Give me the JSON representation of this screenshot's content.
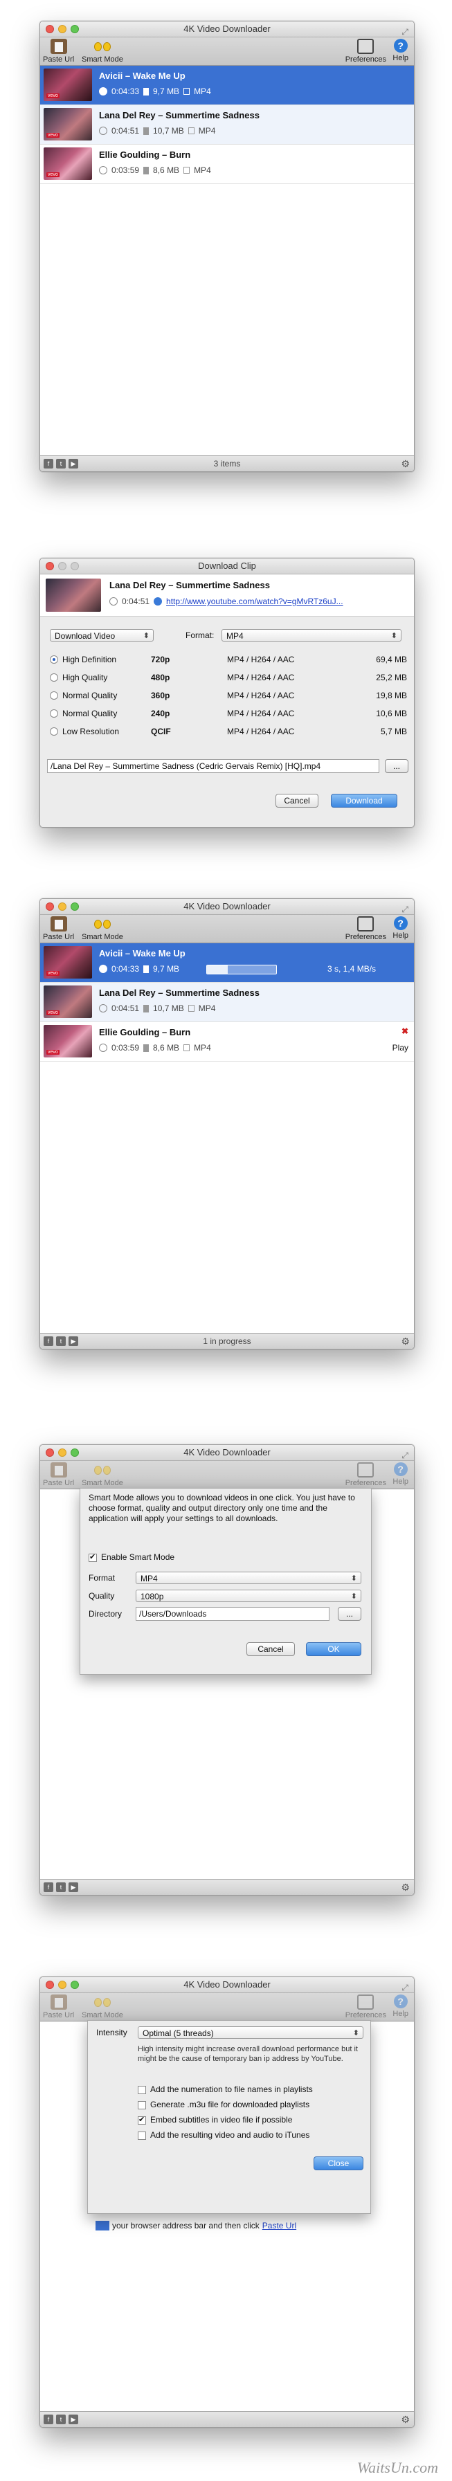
{
  "app": {
    "title": "4K Video Downloader"
  },
  "toolbar": {
    "paste_url": "Paste Url",
    "smart_mode": "Smart Mode",
    "preferences": "Preferences",
    "help": "Help",
    "help_glyph": "?"
  },
  "items": [
    {
      "title": "Avicii – Wake Me Up",
      "duration": "0:04:33",
      "size": "9,7 MB",
      "format": "MP4"
    },
    {
      "title": "Lana Del Rey – Summertime Sadness",
      "duration": "0:04:51",
      "size": "10,7 MB",
      "format": "MP4"
    },
    {
      "title": "Ellie Goulding – Burn",
      "duration": "0:03:59",
      "size": "8,6 MB",
      "format": "MP4"
    }
  ],
  "thumb_badge": "vevo",
  "status1": "3 items",
  "status2": "1 in progress",
  "download_progress": {
    "percent": 30,
    "label": "3 s, 1,4 MB/s"
  },
  "burn_action": "Play",
  "dialog": {
    "title": "Download Clip",
    "clip_title": "Lana Del Rey – Summertime Sadness",
    "duration": "0:04:51",
    "url": "http://www.youtube.com/watch?v=gMvRTz6uJ...",
    "action": "Download Video",
    "format_label": "Format:",
    "format_value": "MP4",
    "qualities": [
      {
        "name": "High Definition",
        "res": "720p",
        "codec": "MP4 / H264 / AAC",
        "size": "69,4 MB",
        "selected": true
      },
      {
        "name": "High Quality",
        "res": "480p",
        "codec": "MP4 / H264 / AAC",
        "size": "25,2 MB",
        "selected": false
      },
      {
        "name": "Normal Quality",
        "res": "360p",
        "codec": "MP4 / H264 / AAC",
        "size": "19,8 MB",
        "selected": false
      },
      {
        "name": "Normal Quality",
        "res": "240p",
        "codec": "MP4 / H264 / AAC",
        "size": "10,6 MB",
        "selected": false
      },
      {
        "name": "Low Resolution",
        "res": "QCIF",
        "codec": "MP4 / H264 / AAC",
        "size": "5,7 MB",
        "selected": false
      }
    ],
    "filepath": "/Lana Del Rey – Summertime Sadness (Cedric Gervais Remix) [HQ].mp4",
    "browse": "...",
    "cancel": "Cancel",
    "download": "Download"
  },
  "smart": {
    "text": "Smart Mode allows you to download videos in one click. You just have to choose format, quality and output directory only one time and the application will apply your settings to all downloads.",
    "enable": "Enable Smart Mode",
    "format_label": "Format",
    "format_value": "MP4",
    "quality_label": "Quality",
    "quality_value": "1080p",
    "directory_label": "Directory",
    "directory_value": "/Users/Downloads",
    "browse": "...",
    "cancel": "Cancel",
    "ok": "OK"
  },
  "prefs": {
    "intensity_label": "Intensity",
    "intensity_value": "Optimal (5 threads)",
    "intensity_note": "High intensity might increase overall download performance but it might be the cause of temporary ban ip address by YouTube.",
    "options": [
      {
        "label": "Add the numeration to file names in playlists",
        "checked": false
      },
      {
        "label": "Generate .m3u file for downloaded playlists",
        "checked": false
      },
      {
        "label": "Embed subtitles in video file if possible",
        "checked": true
      },
      {
        "label": "Add the resulting video and audio to iTunes",
        "checked": false
      }
    ],
    "close": "Close",
    "background_hint": "your browser address bar and then click",
    "background_link": "Paste Url"
  },
  "watermark": "WaitsUn.com"
}
